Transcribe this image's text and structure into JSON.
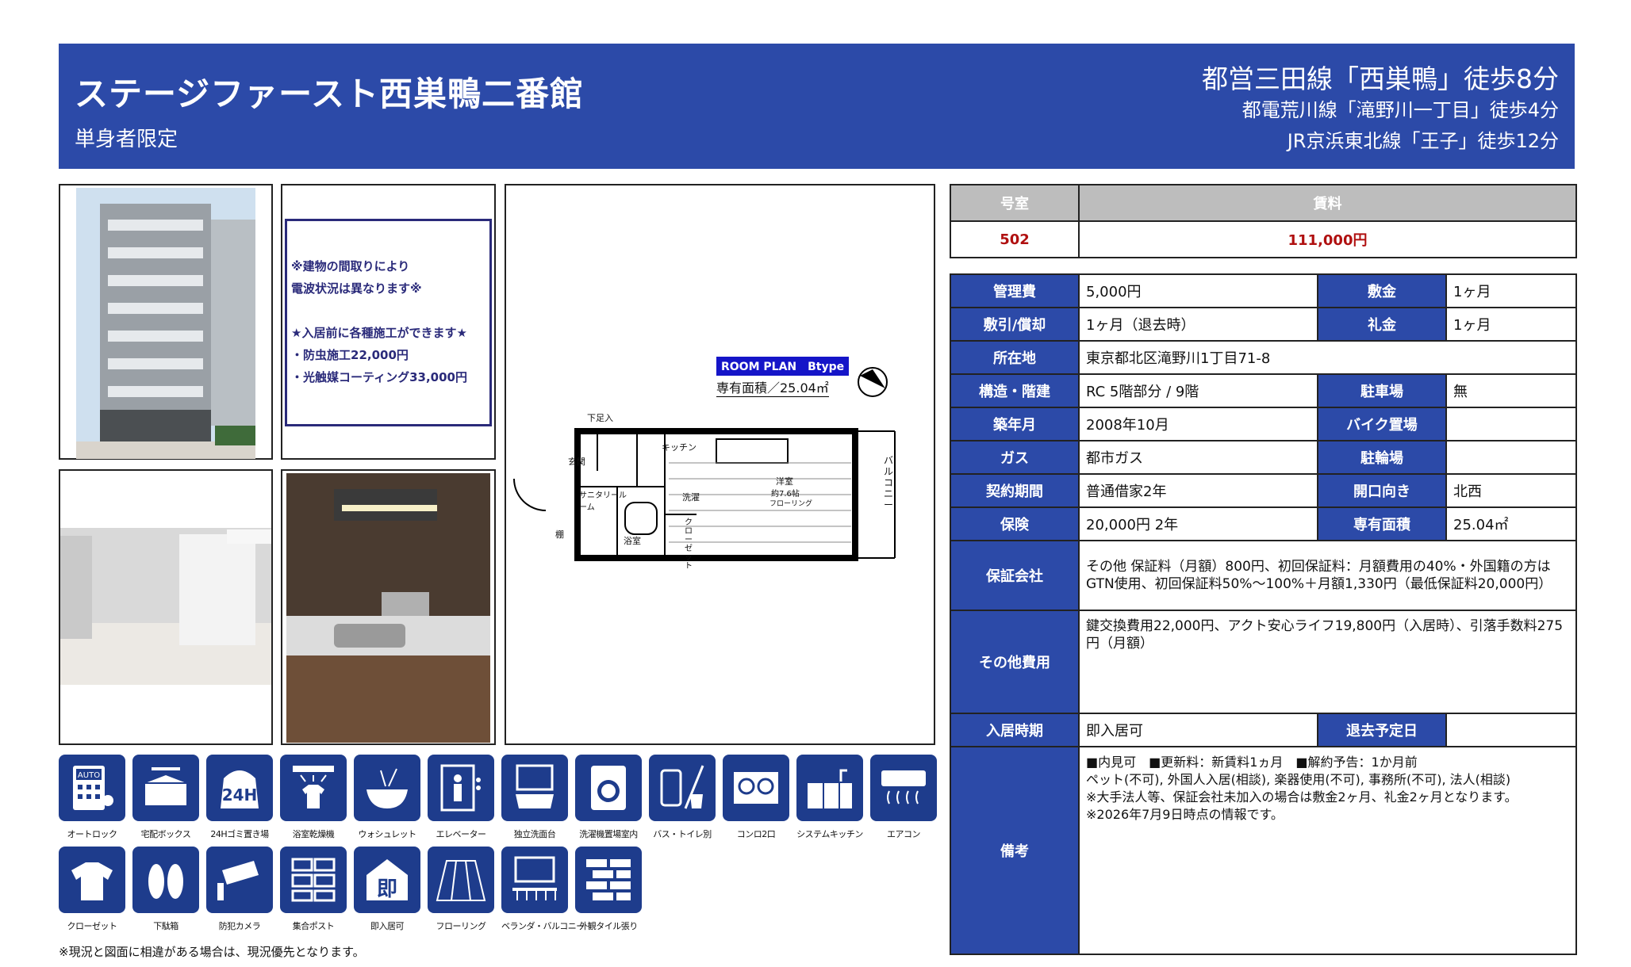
{
  "header": {
    "title": "ステージファースト西巣鴨二番館",
    "subtitle": "単身者限定",
    "stations": [
      "都営三田線「西巣鴨」徒歩8分",
      "都電荒川線「滝野川一丁目」徒歩4分",
      "JR京浜東北線「王子」徒歩12分"
    ]
  },
  "notice": {
    "lines": [
      "※建物の間取りにより",
      "電波状況は異なります※",
      "",
      "★入居前に各種施工ができます★",
      "・防虫施工22,000円",
      "・光触媒コーティング33,000円"
    ]
  },
  "floorplan": {
    "badge": "ROOM PLAN　Btype",
    "area": "専有面積／25.04㎡",
    "rooms": {
      "shoe": "下足入",
      "entrance": "玄関",
      "kitchen": "キッチン",
      "sanitary": "サニタリールーム",
      "laundry": "洗濯",
      "bath": "浴室",
      "closet": "クローゼット",
      "shelf": "棚",
      "western": "洋室",
      "western_size": "約7.6帖",
      "flooring": "フローリング",
      "balcony": "バルコニー"
    }
  },
  "rent_table": {
    "room_label": "号室",
    "rent_label": "賃料",
    "room": "502",
    "rent": "111,000円"
  },
  "details": {
    "kanrihi_label": "管理費",
    "kanrihi": "5,000円",
    "shikikin_label": "敷金",
    "shikikin": "1ヶ月",
    "shikibiki_label": "敷引/償却",
    "shikibiki": "1ヶ月（退去時）",
    "reikin_label": "礼金",
    "reikin": "1ヶ月",
    "address_label": "所在地",
    "address": "東京都北区滝野川1丁目71-8",
    "structure_label": "構造・階建",
    "structure": "RC 5階部分 / 9階",
    "parking_label": "駐車場",
    "parking": "無",
    "built_label": "築年月",
    "built": "2008年10月",
    "bike_label": "バイク置場",
    "bike": "",
    "gas_label": "ガス",
    "gas": "都市ガス",
    "bicycle_label": "駐輪場",
    "bicycle": "",
    "contract_label": "契約期間",
    "contract": "普通借家2年",
    "direction_label": "開口向き",
    "direction": "北西",
    "insurance_label": "保険",
    "insurance": "20,000円 2年",
    "area_label": "専有面積",
    "area": "25.04㎡",
    "guarantor_label": "保証会社",
    "guarantor": "その他 保証料（月額）800円、初回保証料：月額費用の40%・外国籍の方はGTN使用、初回保証料50%〜100%＋月額1,330円（最低保証料20,000円）",
    "other_label": "その他費用",
    "other": "鍵交換費用22,000円、アクト安心ライフ19,800円（入居時）、引落手数料275円（月額）",
    "movein_label": "入居時期",
    "movein": "即入居可",
    "moveout_label": "退去予定日",
    "moveout": "",
    "remarks_label": "備考",
    "remarks": [
      "■内見可　■更新料：新賃料1ヵ月　■解約予告：1か月前",
      "ペット(不可), 外国人入居(相談), 楽器使用(不可), 事務所(不可), 法人(相談)",
      "※大手法人等、保証会社未加入の場合は敷金2ヶ月、礼金2ヶ月となります。",
      "※2026年7月9日時点の情報です。"
    ]
  },
  "amenities": [
    {
      "label": "オートロック",
      "icon": "autolock-icon"
    },
    {
      "label": "宅配ボックス",
      "icon": "delivery-box-icon"
    },
    {
      "label": "24Hゴミ置き場",
      "icon": "garbage-24h-icon"
    },
    {
      "label": "浴室乾燥機",
      "icon": "bath-dryer-icon"
    },
    {
      "label": "ウォシュレット",
      "icon": "washlet-icon"
    },
    {
      "label": "エレベーター",
      "icon": "elevator-icon"
    },
    {
      "label": "独立洗面台",
      "icon": "vanity-icon"
    },
    {
      "label": "洗濯機置場室内",
      "icon": "washer-icon"
    },
    {
      "label": "バス・トイレ別",
      "icon": "bath-toilet-icon"
    },
    {
      "label": "コンロ2口",
      "icon": "stove-icon"
    },
    {
      "label": "システムキッチン",
      "icon": "kitchen-icon"
    },
    {
      "label": "エアコン",
      "icon": "aircon-icon"
    },
    {
      "label": "クローゼット",
      "icon": "closet-icon"
    },
    {
      "label": "下駄箱",
      "icon": "shoe-box-icon"
    },
    {
      "label": "防犯カメラ",
      "icon": "camera-icon"
    },
    {
      "label": "集合ポスト",
      "icon": "mailbox-icon"
    },
    {
      "label": "即入居可",
      "icon": "immediate-icon"
    },
    {
      "label": "フローリング",
      "icon": "flooring-icon"
    },
    {
      "label": "ベランダ・バルコニー",
      "icon": "balcony-icon"
    },
    {
      "label": "外観タイル張り",
      "icon": "tile-icon"
    }
  ],
  "footer_note": "※現況と図面に相違がある場合は、現況優先となります。",
  "icon_texts": {
    "autolock": "AUTO",
    "h24": "24H",
    "immediate": "即"
  }
}
